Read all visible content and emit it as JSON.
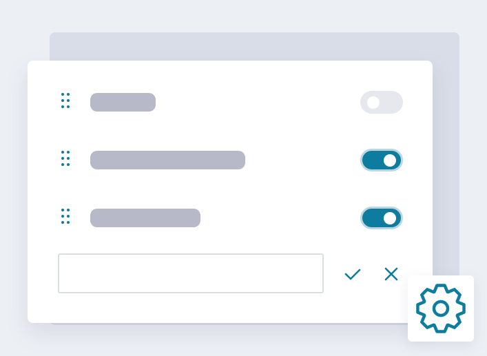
{
  "colors": {
    "accent": "#0e7c9e",
    "toggle_off": "#e6e8ee",
    "label_placeholder": "#b7b9c8",
    "background": "#eceff4",
    "back_card": "#d9dde7",
    "card": "#ffffff"
  },
  "settings_list": {
    "rows": [
      {
        "label_placeholder": "short",
        "label_fraction": 0.22,
        "enabled": false,
        "handle_icon": "drag-handle-icon"
      },
      {
        "label_placeholder": "long",
        "label_fraction": 0.52,
        "enabled": true,
        "handle_icon": "drag-handle-icon"
      },
      {
        "label_placeholder": "medium",
        "label_fraction": 0.37,
        "enabled": true,
        "handle_icon": "drag-handle-icon"
      }
    ]
  },
  "new_entry": {
    "value": "",
    "placeholder": "",
    "confirm_icon": "checkmark-icon",
    "cancel_icon": "close-icon"
  },
  "settings_button": {
    "icon": "gear-icon"
  }
}
